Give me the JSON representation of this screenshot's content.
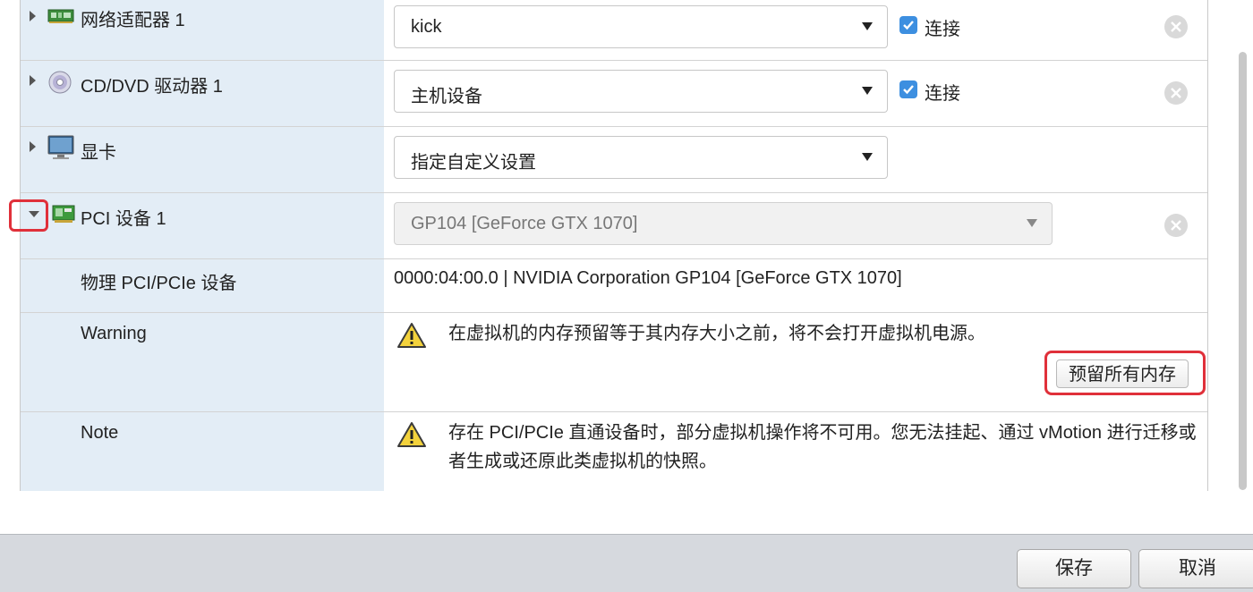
{
  "devices": {
    "network": {
      "label": "网络适配器 1",
      "icon": "network-adapter-icon",
      "select_value": "kick",
      "connect_label": "连接",
      "connected": true
    },
    "cddvd": {
      "label": "CD/DVD 驱动器 1",
      "icon": "cd-dvd-icon",
      "select_value": "主机设备",
      "connect_label": "连接",
      "connected": true
    },
    "video": {
      "label": "显卡",
      "icon": "monitor-icon",
      "select_value": "指定自定义设置"
    },
    "pci": {
      "label": "PCI 设备 1",
      "icon": "pci-card-icon",
      "select_value": "GP104 [GeForce GTX 1070]",
      "expanded": true
    }
  },
  "pci_details": {
    "physical_label": "物理 PCI/PCIe 设备",
    "physical_value": "0000:04:00.0 | NVIDIA Corporation GP104 [GeForce GTX 1070]",
    "warning_label": "Warning",
    "warning_message": "在虚拟机的内存预留等于其内存大小之前，将不会打开虚拟机电源。",
    "reserve_button": "预留所有内存",
    "note_label": "Note",
    "note_message": "存在 PCI/PCIe 直通设备时，部分虚拟机操作将不可用。您无法挂起、通过 vMotion 进行迁移或者生成或还原此类虚拟机的快照。"
  },
  "footer": {
    "save_label": "保存",
    "cancel_label": "取消"
  },
  "colors": {
    "highlight": "#e0303a",
    "checkbox": "#3d8fe0",
    "label_column": "#e3edf6",
    "footer": "#d6d9de"
  }
}
